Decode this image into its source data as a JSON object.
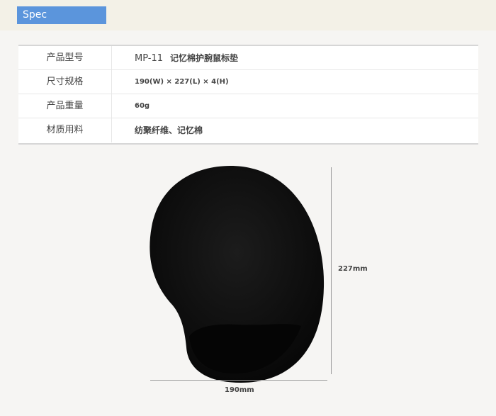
{
  "header": {
    "tab_label": "Spec"
  },
  "spec": {
    "rows": [
      {
        "label": "产品型号",
        "model": "MP-11",
        "value": "记忆棉护腕鼠标垫"
      },
      {
        "label": "尺寸规格",
        "value": "190(W) × 227(L) × 4(H)"
      },
      {
        "label": "产品重量",
        "value": "60g"
      },
      {
        "label": "材质用料",
        "value": "纺聚纤维、记忆棉"
      }
    ]
  },
  "product": {
    "height_label": "227mm",
    "width_label": "190mm",
    "pad_color": "#0d0d0d"
  }
}
